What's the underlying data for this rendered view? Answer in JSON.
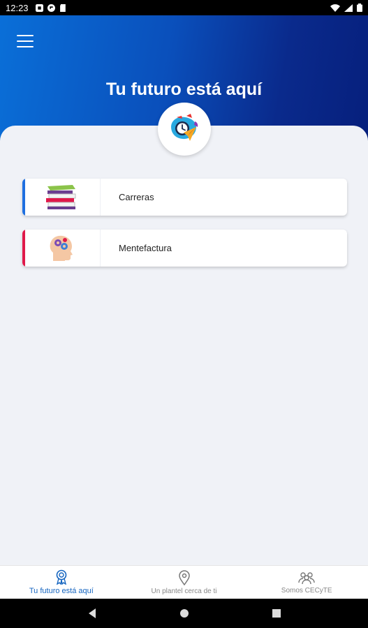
{
  "status_bar": {
    "time": "12:23"
  },
  "header": {
    "title": "Tu futuro está aquí"
  },
  "cards": [
    {
      "label": "Carreras",
      "accent": "#1e6fe0",
      "icon": "books-icon"
    },
    {
      "label": "Mentefactura",
      "accent": "#e0194a",
      "icon": "brain-gears-icon"
    }
  ],
  "bottom_nav": [
    {
      "label": "Tu futuro está aquí",
      "icon": "award-icon",
      "active": true
    },
    {
      "label": "Un plantel cerca de ti",
      "icon": "location-pin-icon",
      "active": false
    },
    {
      "label": "Somos CECyTE",
      "icon": "group-icon",
      "active": false
    }
  ],
  "colors": {
    "primary": "#1565c0",
    "header_start": "#0a6fd8",
    "header_end": "#061f7c",
    "background": "#f0f2f7"
  }
}
